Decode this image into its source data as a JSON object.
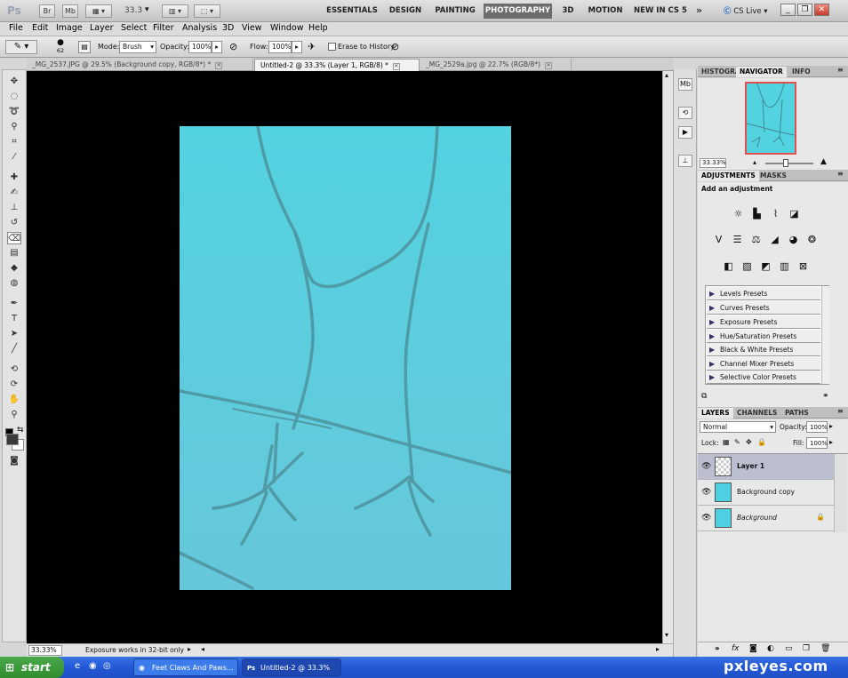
{
  "appbar": {
    "logo": "Ps",
    "br_label": "Br",
    "mb_label": "Mb",
    "zoom_value": "33.3",
    "workspaces": [
      {
        "label": "ESSENTIALS",
        "active": false
      },
      {
        "label": "DESIGN",
        "active": false
      },
      {
        "label": "PAINTING",
        "active": false
      },
      {
        "label": "PHOTOGRAPHY",
        "active": true
      },
      {
        "label": "3D",
        "active": false
      },
      {
        "label": "MOTION",
        "active": false
      },
      {
        "label": "NEW IN CS 5",
        "active": false
      }
    ],
    "more_label": "»",
    "cslive_label": "CS Live"
  },
  "menubar": [
    "File",
    "Edit",
    "Image",
    "Layer",
    "Select",
    "Filter",
    "Analysis",
    "3D",
    "View",
    "Window",
    "Help"
  ],
  "options": {
    "brush_size": "62",
    "mode_label": "Mode:",
    "mode_value": "Brush",
    "opacity_label": "Opacity:",
    "opacity_value": "100%",
    "flow_label": "Flow:",
    "flow_value": "100%",
    "erase_history_label": "Erase to History"
  },
  "tabs": [
    {
      "label": "_MG_2537.JPG @ 29.5% (Background copy, RGB/8*) *",
      "active": false
    },
    {
      "label": "Untitled-2 @ 33.3% (Layer 1, RGB/8) *",
      "active": true
    },
    {
      "label": "_MG_2529a.jpg @ 22.7% (RGB/8*)",
      "active": false
    }
  ],
  "status": {
    "zoom": "33.33%",
    "message": "Exposure works in 32-bit only"
  },
  "navigator": {
    "tabs": [
      "HISTOGRAM",
      "NAVIGATOR",
      "INFO"
    ],
    "active_tab": "NAVIGATOR",
    "zoom": "33.33%"
  },
  "adjustments": {
    "tabs": [
      "ADJUSTMENTS",
      "MASKS"
    ],
    "heading": "Add an adjustment",
    "presets": [
      "Levels Presets",
      "Curves Presets",
      "Exposure Presets",
      "Hue/Saturation Presets",
      "Black & White Presets",
      "Channel Mixer Presets",
      "Selective Color Presets"
    ]
  },
  "layers": {
    "tabs": [
      "LAYERS",
      "CHANNELS",
      "PATHS"
    ],
    "blend_mode": "Normal",
    "opacity_label": "Opacity:",
    "opacity_value": "100%",
    "lock_label": "Lock:",
    "fill_label": "Fill:",
    "fill_value": "100%",
    "items": [
      {
        "name": "Layer 1",
        "selected": true
      },
      {
        "name": "Background copy",
        "selected": false
      },
      {
        "name": "Background",
        "selected": false
      }
    ]
  },
  "taskbar": {
    "start_label": "start",
    "tasks": [
      "Feet Claws And Paws...",
      "Untitled-2 @ 33.3% (..."
    ]
  },
  "watermark": "pxleyes.com",
  "colors": {
    "canvas": "#53d2e0",
    "workspace_bg": "#000000",
    "active_workspace": "#6d6d6d",
    "taskbar": "#245ad8"
  }
}
